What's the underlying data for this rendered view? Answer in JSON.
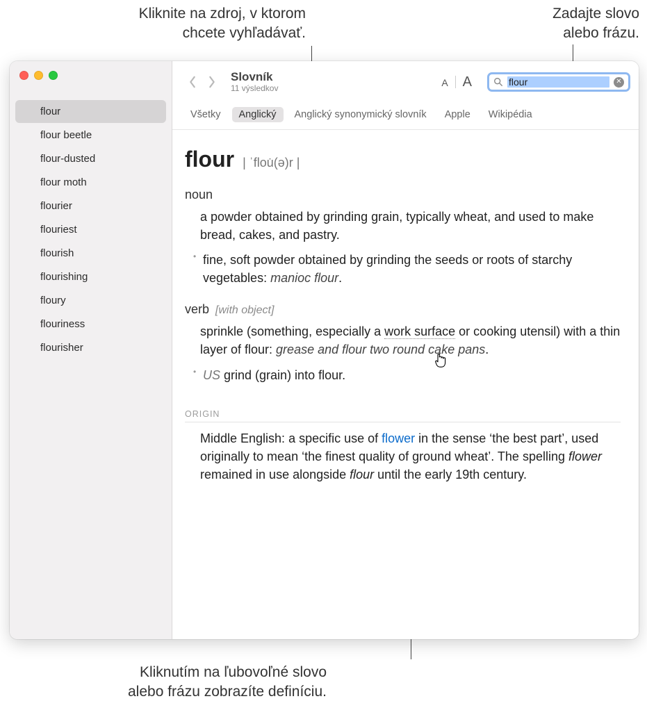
{
  "callouts": {
    "top_left": "Kliknite na zdroj, v ktorom\nchcete vyhľadávať.",
    "top_right": "Zadajte slovo\nalebo frázu.",
    "bottom": "Kliknutím na ľubovoľné slovo\nalebo frázu zobrazíte definíciu."
  },
  "toolbar": {
    "title": "Slovník",
    "subtitle": "11 výsledkov",
    "font_small": "A",
    "font_big": "A"
  },
  "search": {
    "value": "flour"
  },
  "sources": {
    "items": [
      {
        "label": "Všetky",
        "active": false
      },
      {
        "label": "Anglický",
        "active": true
      },
      {
        "label": "Anglický synonymický slovník",
        "active": false
      },
      {
        "label": "Apple",
        "active": false
      },
      {
        "label": "Wikipédia",
        "active": false
      }
    ]
  },
  "sidebar": {
    "items": [
      {
        "label": "flour",
        "selected": true
      },
      {
        "label": "flour beetle",
        "selected": false
      },
      {
        "label": "flour-dusted",
        "selected": false
      },
      {
        "label": "flour moth",
        "selected": false
      },
      {
        "label": "flourier",
        "selected": false
      },
      {
        "label": "flouriest",
        "selected": false
      },
      {
        "label": "flourish",
        "selected": false
      },
      {
        "label": "flourishing",
        "selected": false
      },
      {
        "label": "floury",
        "selected": false
      },
      {
        "label": "flouriness",
        "selected": false
      },
      {
        "label": "flourisher",
        "selected": false
      }
    ]
  },
  "entry": {
    "headword": "flour",
    "pronunciation": "| ˈflou̇(ə)r |",
    "noun": {
      "pos": "noun",
      "def1": "a powder obtained by grinding grain, typically wheat, and used to make bread, cakes, and pastry.",
      "sub1_pre": "fine, soft powder obtained by grinding the seeds or roots of starchy vegetables: ",
      "sub1_ex": "manioc flour",
      "sub1_post": "."
    },
    "verb": {
      "pos": "verb",
      "note": "[with object]",
      "def1_a": "sprinkle (something, especially a ",
      "def1_link": "work surface",
      "def1_b": " or cooking utensil) with a thin layer of flour: ",
      "def1_ex": "grease and flour two round cake pans",
      "def1_c": ".",
      "sub1_region": "US",
      "sub1_text": " grind (grain) into flour."
    },
    "origin": {
      "heading": "ORIGIN",
      "a": "Middle English: a specific use of ",
      "link": "flower",
      "b": " in the sense ‘the best part’, used originally to mean ‘the finest quality of ground wheat’. The spelling ",
      "it1": "flower",
      "c": " remained in use alongside ",
      "it2": "flour",
      "d": " until the early 19th century."
    }
  }
}
